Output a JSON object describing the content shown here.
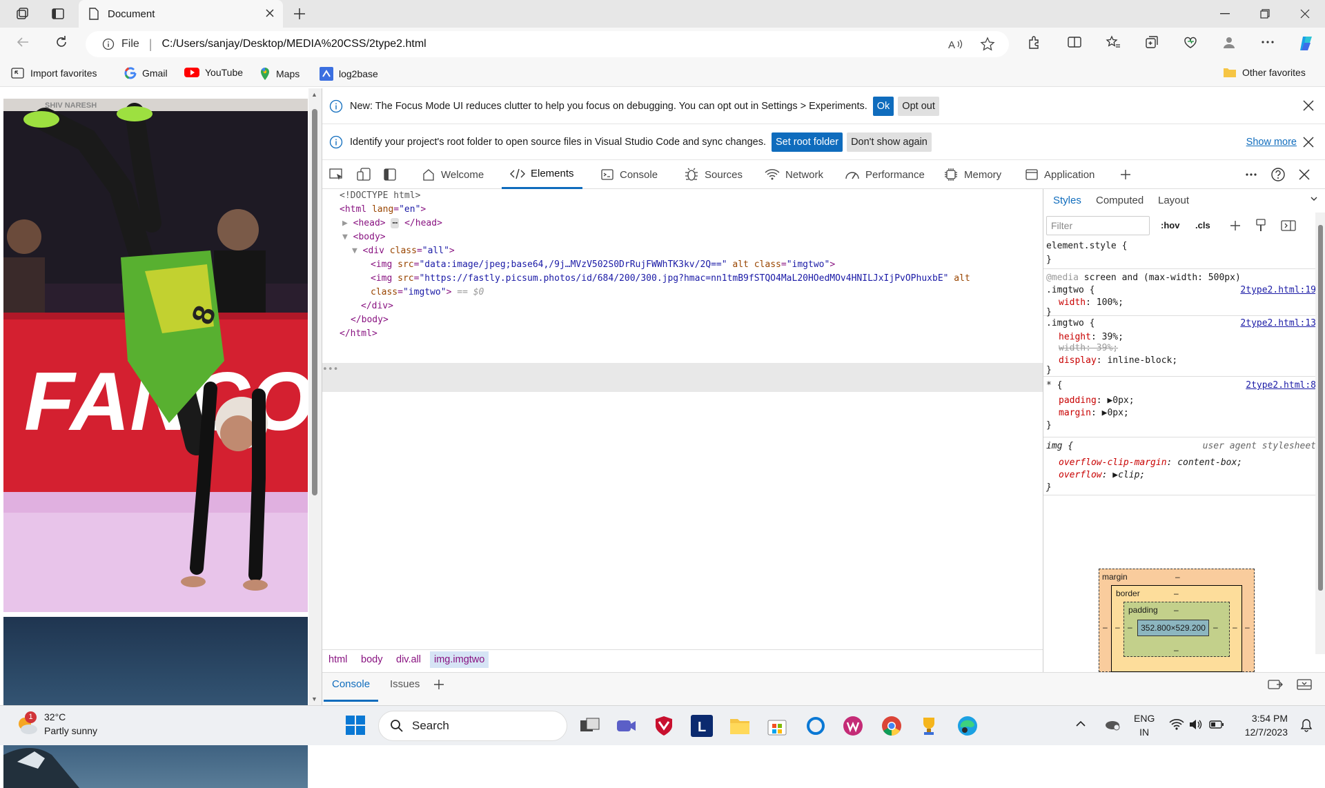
{
  "browser": {
    "tab_title": "Document",
    "address": {
      "scheme_label": "File",
      "url": "C:/Users/sanjay/Desktop/MEDIA%20CSS/2type2.html"
    },
    "favorites": [
      {
        "label": "Import favorites",
        "icon": "import-icon"
      },
      {
        "label": "Gmail",
        "icon": "google-icon"
      },
      {
        "label": "YouTube",
        "icon": "youtube-icon"
      },
      {
        "label": "Maps",
        "icon": "maps-pin-icon"
      },
      {
        "label": "log2base",
        "icon": "log2base-icon"
      }
    ],
    "other_favorites": "Other favorites"
  },
  "preview": {
    "banner_text": "FANCO",
    "jersey_number": "8",
    "header_strip": "SHIV NARESH"
  },
  "devtools": {
    "info1": {
      "text": "New: The Focus Mode UI reduces clutter to help you focus on debugging. You can opt out in Settings > Experiments.",
      "ok": "Ok",
      "optout": "Opt out"
    },
    "info2": {
      "text": "Identify your project's root folder to open source files in Visual Studio Code and sync changes.",
      "set_root": "Set root folder",
      "dont_show": "Don't show again",
      "show_more": "Show more"
    },
    "tabs": [
      "Welcome",
      "Elements",
      "Console",
      "Sources",
      "Network",
      "Performance",
      "Memory",
      "Application"
    ],
    "active_tab": "Elements",
    "dom": {
      "doctype": "<!DOCTYPE html>",
      "html_open": "<html",
      "lang_attr": "lang",
      "lang_val": "\"en\"",
      "head": "<head>",
      "head_close": "</head>",
      "body": "<body>",
      "div_open": "<div",
      "div_class_attr": "class",
      "div_class_val": "\"all\"",
      "img_tag": "<img",
      "img1_src_attr": "src",
      "img1_src_val": "\"data:image/jpeg;base64,/9j…MVzV502S0DrRujFWWhTK3kv/2Q==\"",
      "img1_alt": "alt",
      "img1_class_attr": "class",
      "img1_class_val": "\"imgtwo\"",
      "img2_src_val": "\"https://fastly.picsum.photos/id/684/200/300.jpg?hmac=nn1tmB9fSTQO4MaL20HOedMOv4HNILJxIjPvOPhuxbE\"",
      "img2_alt": "alt",
      "img2_class_attr": "class",
      "img2_class_val": "\"imgtwo\"",
      "sel_marker": "== $0",
      "div_close": "</div>",
      "body_close": "</body>",
      "html_close": "</html>",
      "ellipsis": "•••"
    },
    "breadcrumbs": [
      "html",
      "body",
      "div.all",
      "img.imgtwo"
    ],
    "styles": {
      "tabs": [
        "Styles",
        "Computed",
        "Layout"
      ],
      "filter_placeholder": "Filter",
      "hov": ":hov",
      "cls": ".cls",
      "element_style": "element.style {",
      "close": "}",
      "media_kw": "@media",
      "media_q": "screen and (max-width: 500px)",
      "r1_sel": ".imgtwo {",
      "r1_src": "2type2.html:19",
      "r1_p1": "width",
      "r1_v1": "100%;",
      "r2_sel": ".imgtwo {",
      "r2_src": "2type2.html:13",
      "r2_p1": "height",
      "r2_v1": "39%;",
      "r2_p2": "width: 39%;",
      "r2_p3": "display",
      "r2_v3": "inline-block;",
      "r3_sel": "* {",
      "r3_src": "2type2.html:8",
      "r3_p1": "padding",
      "r3_v1": "0px;",
      "r3_p2": "margin",
      "r3_v2": "0px;",
      "r4_sel": "img {",
      "r4_src": "user agent stylesheet",
      "r4_p1": "overflow-clip-margin",
      "r4_v1": "content-box;",
      "r4_p2": "overflow",
      "r4_v2": "clip;"
    },
    "boxmodel": {
      "margin": "margin",
      "border": "border",
      "padding": "padding",
      "dash": "–",
      "content": "352.800×529.200"
    },
    "drawer": {
      "console": "Console",
      "issues": "Issues"
    }
  },
  "taskbar": {
    "weather_temp": "32°C",
    "weather_desc": "Partly sunny",
    "weather_badge": "1",
    "search": "Search",
    "lang": "ENG",
    "region": "IN",
    "time": "3:54 PM",
    "date": "12/7/2023",
    "l_app": "L"
  }
}
